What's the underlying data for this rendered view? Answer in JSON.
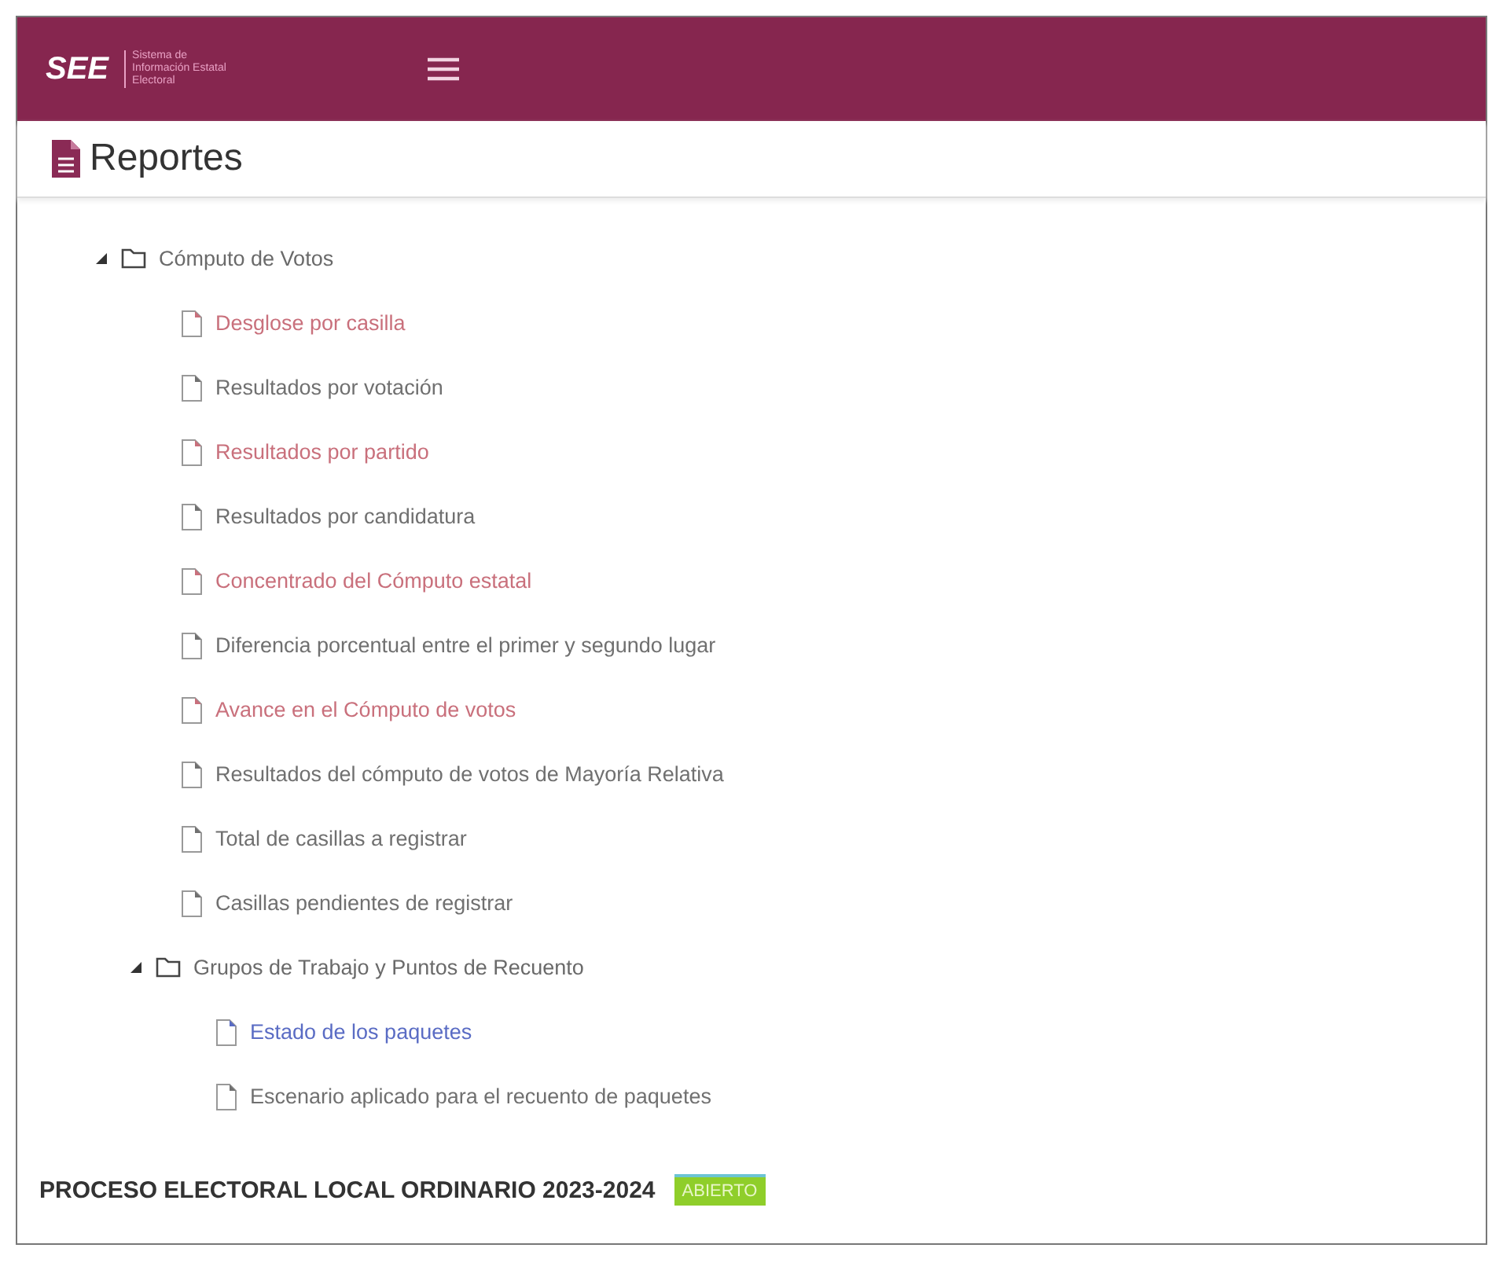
{
  "header": {
    "logo": "SEE",
    "subtitle": "Sistema de Información Estatal Electoral"
  },
  "page": {
    "title": "Reportes"
  },
  "tree": [
    {
      "label": "Cómputo de Votos",
      "kind": "folder",
      "expanded": true,
      "children": [
        {
          "label": "Desglose por casilla",
          "kind": "report",
          "color": "#c9707c"
        },
        {
          "label": "Resultados por votación",
          "kind": "report",
          "color": "#707070"
        },
        {
          "label": "Resultados por partido",
          "kind": "report",
          "color": "#c9707c"
        },
        {
          "label": "Resultados por candidatura",
          "kind": "report",
          "color": "#707070"
        },
        {
          "label": "Concentrado del Cómputo estatal",
          "kind": "report",
          "color": "#c9707c"
        },
        {
          "label": "Diferencia porcentual entre el primer y segundo lugar",
          "kind": "report",
          "color": "#707070"
        },
        {
          "label": "Avance en el Cómputo de votos",
          "kind": "report",
          "color": "#c9707c"
        },
        {
          "label": "Resultados del cómputo de votos de Mayoría Relativa",
          "kind": "report",
          "color": "#707070"
        },
        {
          "label": "Total de casillas a registrar",
          "kind": "report",
          "color": "#707070"
        },
        {
          "label": "Casillas pendientes de registrar",
          "kind": "report",
          "color": "#707070"
        },
        {
          "label": "Grupos de Trabajo y Puntos de Recuento",
          "kind": "folder",
          "expanded": true,
          "children": [
            {
              "label": "Estado de los paquetes",
              "kind": "report",
              "color": "#5a6cc4"
            },
            {
              "label": "Escenario aplicado para el recuento de paquetes",
              "kind": "report",
              "color": "#707070"
            }
          ]
        }
      ]
    }
  ],
  "footer": {
    "process": "PROCESO ELECTORAL LOCAL ORDINARIO 2023-2024",
    "status": "ABIERTO"
  }
}
